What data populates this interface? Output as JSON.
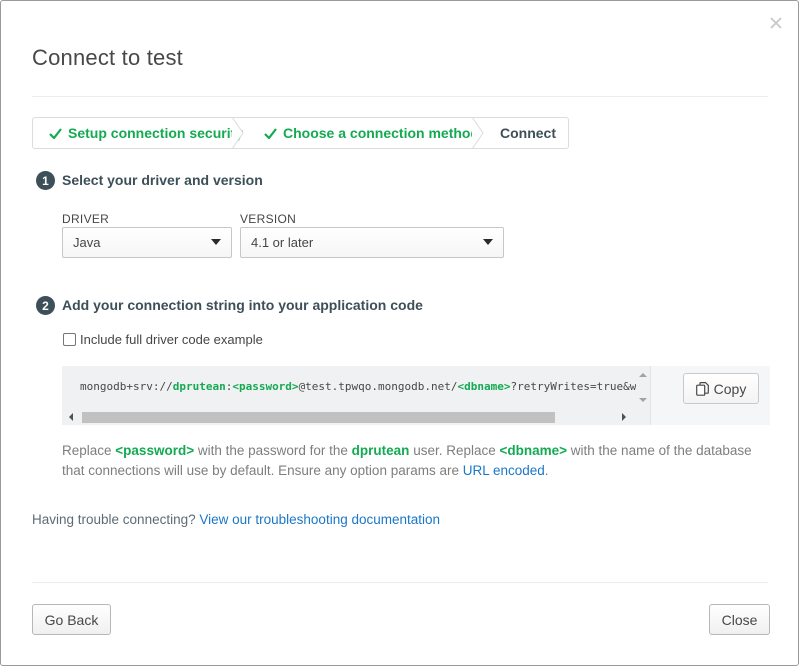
{
  "modal": {
    "title": "Connect to test",
    "close_icon": "close-icon"
  },
  "steps": [
    {
      "label": "Setup connection security",
      "done": true
    },
    {
      "label": "Choose a connection method",
      "done": true
    },
    {
      "label": "Connect",
      "done": false
    }
  ],
  "section1": {
    "number": "1",
    "title": "Select your driver and version",
    "driver_label": "DRIVER",
    "driver_value": "Java",
    "version_label": "VERSION",
    "version_value": "4.1 or later"
  },
  "section2": {
    "number": "2",
    "title": "Add your connection string into your application code",
    "checkbox_label": "Include full driver code example",
    "checkbox_checked": false,
    "conn": {
      "prefix": "mongodb+srv://",
      "user": "dprutean",
      "sep": ":",
      "password": "<password>",
      "host": "@test.tpwqo.mongodb.net/",
      "dbname": "<dbname>",
      "suffix": "?retryWrites=true&w"
    },
    "copy_label": "Copy"
  },
  "help": {
    "t1": "Replace ",
    "password": "<password>",
    "t2": " with the password for the ",
    "user": "dprutean",
    "t3": " user. Replace ",
    "dbname": "<dbname>",
    "t4": " with the name of the database that connections will use by default. Ensure any option params are ",
    "link": "URL encoded",
    "t5": "."
  },
  "trouble": {
    "text": "Having trouble connecting? ",
    "link": "View our troubleshooting documentation"
  },
  "footer": {
    "back_label": "Go Back",
    "close_label": "Close"
  },
  "colors": {
    "accent_green": "#13aa52",
    "link_blue": "#1a77c9",
    "text_dark": "#3d4f58"
  }
}
